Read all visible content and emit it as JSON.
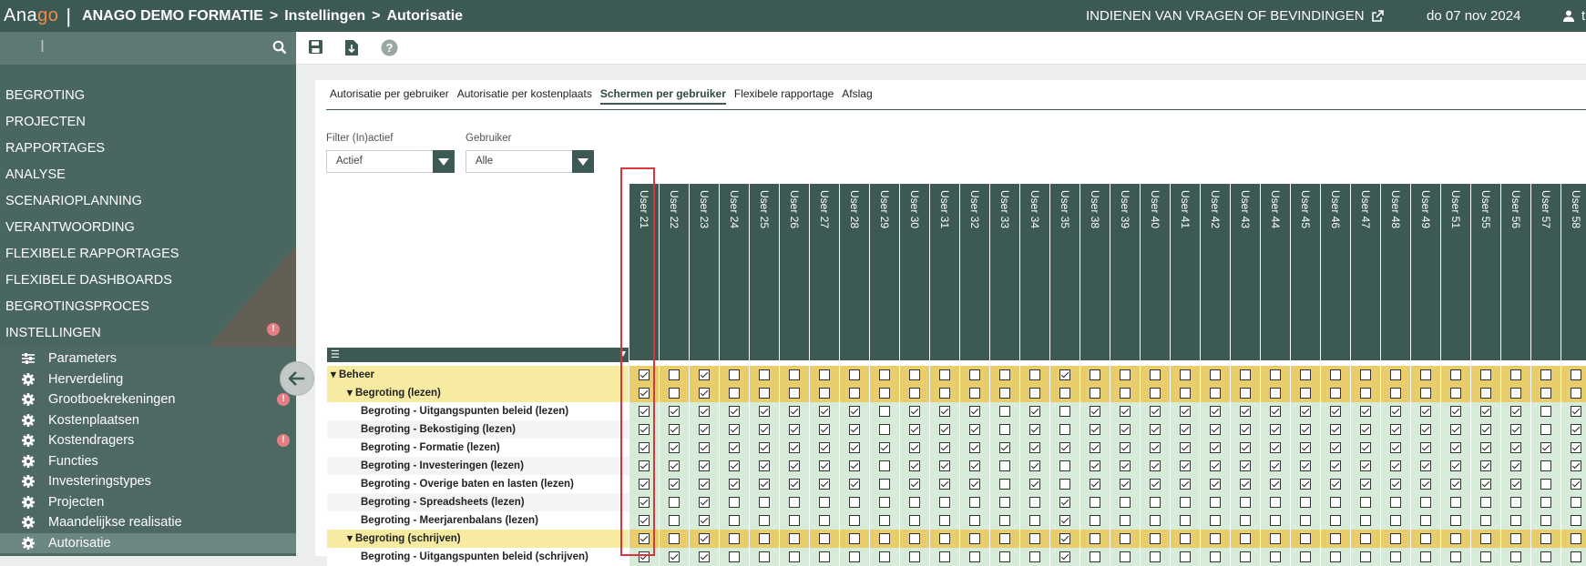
{
  "header": {
    "logo_pre": "Ana",
    "logo_o": "g",
    "logo_post": "o",
    "crumbs": [
      "ANAGO DEMO FORMATIE",
      "Instellingen",
      "Autorisatie"
    ],
    "report_link": "INDIENEN VAN VRAGEN OF BEVINDINGEN",
    "date": "do 07 nov 2024",
    "user_initial": "t"
  },
  "sidebar": {
    "cursor": "I",
    "menu": [
      "BEGROTING",
      "PROJECTEN",
      "RAPPORTAGES",
      "ANALYSE",
      "SCENARIOPLANNING",
      "VERANTWOORDING",
      "FLEXIBELE RAPPORTAGES",
      "FLEXIBELE DASHBOARDS",
      "BEGROTINGSPROCES",
      "INSTELLINGEN"
    ],
    "menu_alert": "!",
    "submenu": [
      {
        "label": "Parameters",
        "icon": "sliders-icon"
      },
      {
        "label": "Herverdeling",
        "icon": "gear-icon"
      },
      {
        "label": "Grootboekrekeningen",
        "icon": "gear-icon",
        "alert": true
      },
      {
        "label": "Kostenplaatsen",
        "icon": "gear-icon"
      },
      {
        "label": "Kostendragers",
        "icon": "gear-icon",
        "alert": true
      },
      {
        "label": "Functies",
        "icon": "gear-icon"
      },
      {
        "label": "Investeringstypes",
        "icon": "gear-icon"
      },
      {
        "label": "Projecten",
        "icon": "gear-icon"
      },
      {
        "label": "Maandelijkse realisatie",
        "icon": "gear-icon"
      },
      {
        "label": "Autorisatie",
        "icon": "gear-icon",
        "active": true
      }
    ]
  },
  "tabs": [
    "Autorisatie per gebruiker",
    "Autorisatie per kostenplaats",
    "Schermen per gebruiker",
    "Flexibele rapportage",
    "Afslag"
  ],
  "active_tab": 2,
  "filters": {
    "status_label": "Filter (In)actief",
    "status_value": "Actief",
    "user_label": "Gebruiker",
    "user_value": "Alle"
  },
  "users": [
    "User 21",
    "User 22",
    "User 23",
    "User 24",
    "User 25",
    "User 26",
    "User 27",
    "User 28",
    "User 29",
    "User 30",
    "User 31",
    "User 32",
    "User 33",
    "User 34",
    "User 35",
    "User 38",
    "User 39",
    "User 40",
    "User 41",
    "User 42",
    "User 43",
    "User 44",
    "User 45",
    "User 46",
    "User 47",
    "User 48",
    "User 49",
    "User 51",
    "User 55",
    "User 56",
    "User 57",
    "User 58"
  ],
  "rows": [
    {
      "label": "Beheer",
      "level": 0,
      "type": "group",
      "checks": "10100000000000100000000000000000"
    },
    {
      "label": "Begroting (lezen)",
      "level": 1,
      "type": "subgroup",
      "checks": "10100000000000000000000000000000"
    },
    {
      "label": "Begroting - Uitgangspunten beleid (lezen)",
      "level": 2,
      "type": "item",
      "checks": "11111111011101011111111111111101"
    },
    {
      "label": "Begroting - Bekostiging (lezen)",
      "level": 2,
      "type": "item",
      "checks": "11111111011101011111111111111101"
    },
    {
      "label": "Begroting - Formatie (lezen)",
      "level": 2,
      "type": "item",
      "checks": "11111111111111111111111111111111"
    },
    {
      "label": "Begroting - Investeringen (lezen)",
      "level": 2,
      "type": "item",
      "checks": "11111111011101011111111111111101"
    },
    {
      "label": "Begroting - Overige baten en lasten (lezen)",
      "level": 2,
      "type": "item",
      "checks": "11111111011101011111111111111101"
    },
    {
      "label": "Begroting - Spreadsheets (lezen)",
      "level": 2,
      "type": "item",
      "checks": "10100000000000100000000000000000"
    },
    {
      "label": "Begroting - Meerjarenbalans (lezen)",
      "level": 2,
      "type": "item",
      "checks": "10100000000000100000000000000000"
    },
    {
      "label": "Begroting (schrijven)",
      "level": 1,
      "type": "subgroup",
      "checks": "10100000000000100000000000000000"
    },
    {
      "label": "Begroting - Uitgangspunten beleid (schrijven)",
      "level": 2,
      "type": "item",
      "checks": "11100000000000100000000000000000"
    }
  ],
  "colors": {
    "header": "#3d5954",
    "sidebar": "#4a6661",
    "group_row": "#f7eba2",
    "group_cell": "#e9cd6d",
    "item_cell": "#d7ebd9",
    "highlight": "#d9353b"
  }
}
